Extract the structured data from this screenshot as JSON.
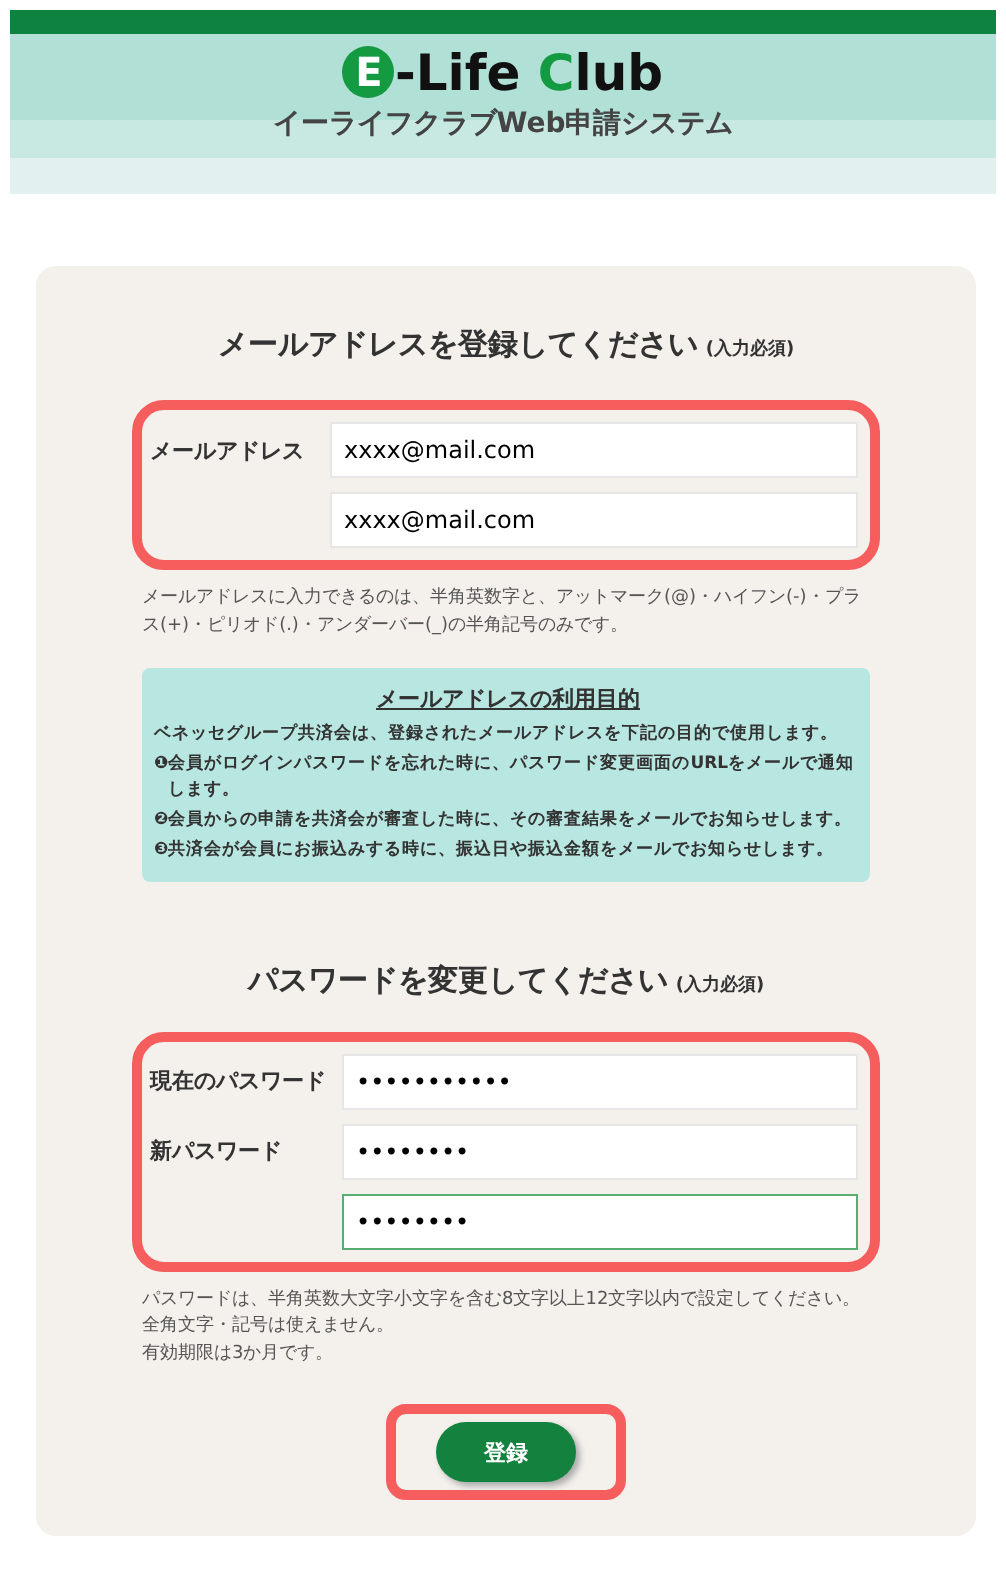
{
  "header": {
    "logo": [
      {
        "text": "E",
        "kind": "circle"
      },
      {
        "text": "-Life ",
        "kind": "plain"
      },
      {
        "text": "C",
        "kind": "green"
      },
      {
        "text": "lub",
        "kind": "plain"
      }
    ],
    "subtitle": "イーライフクラブWeb申請システム"
  },
  "email_section": {
    "title": "メールアドレスを登録してください",
    "required": "(入力必須)",
    "label": "メールアドレス",
    "fields": [
      {
        "value": "xxxx@mail.com",
        "focused": false
      },
      {
        "value": "xxxx@mail.com",
        "focused": false
      }
    ],
    "hint": "メールアドレスに入力できるのは、半角英数字と、アットマーク(@)・ハイフン(-)・プラス(+)・ピリオド(.)・アンダーバー(_)の半角記号のみです。"
  },
  "purpose_box": {
    "title": "メールアドレスの利用目的",
    "intro": "ベネッセグループ共済会は、登録されたメールアドレスを下記の目的で使用します。",
    "items": [
      {
        "mark": "❶",
        "text": "会員がログインパスワードを忘れた時に、パスワード変更画面のURLをメールで通知します。"
      },
      {
        "mark": "❷",
        "text": "会員からの申請を共済会が審査した時に、その審査結果をメールでお知らせします。"
      },
      {
        "mark": "❸",
        "text": "共済会が会員にお振込みする時に、振込日や振込金額をメールでお知らせします。"
      }
    ]
  },
  "password_section": {
    "title": "パスワードを変更してください",
    "required": "(入力必須)",
    "fields": [
      {
        "label": "現在のパスワード",
        "value": "•••••••••••",
        "focused": false
      },
      {
        "label": "新パスワード",
        "value": "••••••••",
        "focused": false
      },
      {
        "value": "••••••••",
        "focused": true
      }
    ],
    "hint": [
      "パスワードは、半角英数大文字小文字を含む8文字以上12文字以内で設定してください。全角文字・記号は使えません。",
      "有効期限は3か月です。"
    ]
  },
  "submit_button": "登録"
}
